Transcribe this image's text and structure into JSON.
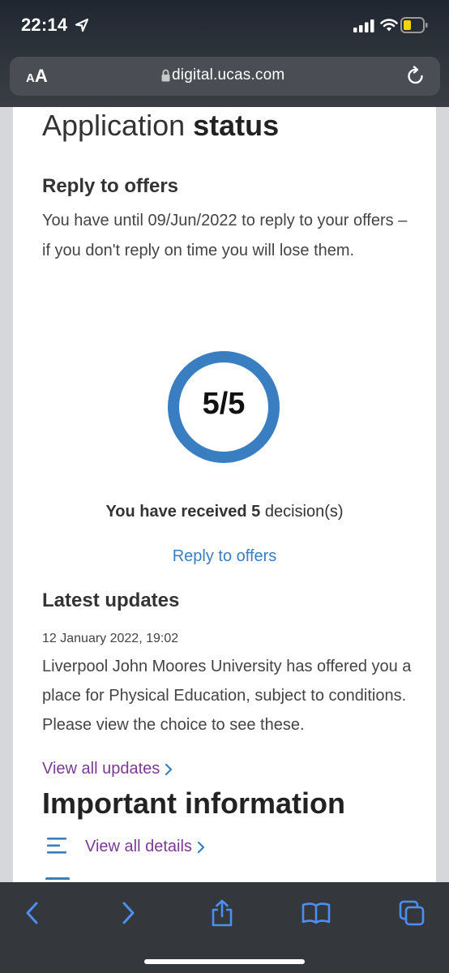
{
  "status_bar": {
    "time": "22:14"
  },
  "browser": {
    "text_size_label_small": "A",
    "text_size_label_large": "A",
    "url": "digital.ucas.com"
  },
  "page": {
    "title_plain": "Application ",
    "title_bold": "status",
    "reply": {
      "heading": "Reply to offers",
      "text": "You have until 09/Jun/2022 to reply to your offers – if you don't reply on time you will lose them."
    },
    "progress": {
      "label": "5/5",
      "received": 5,
      "total": 5,
      "ring_color": "#3a7ec2",
      "decisions_prefix": "You have received 5",
      "decisions_suffix": " decision(s)",
      "link": "Reply to offers"
    },
    "updates": {
      "heading": "Latest updates",
      "date": "12 January 2022, 19:02",
      "text": "Liverpool John Moores University has offered you a place for Physical Education, subject to conditions. Please view the choice to see these.",
      "view_all": "View all updates"
    },
    "important": {
      "heading": "Important information",
      "view_details": "View all details"
    }
  },
  "colors": {
    "link_blue": "#3a7ec2",
    "link_purple": "#7a3a93",
    "toolbar_icon": "#4d8ff0"
  },
  "toolbar": {
    "icons": [
      "back-icon",
      "forward-icon",
      "share-icon",
      "bookmarks-icon",
      "tabs-icon"
    ]
  }
}
